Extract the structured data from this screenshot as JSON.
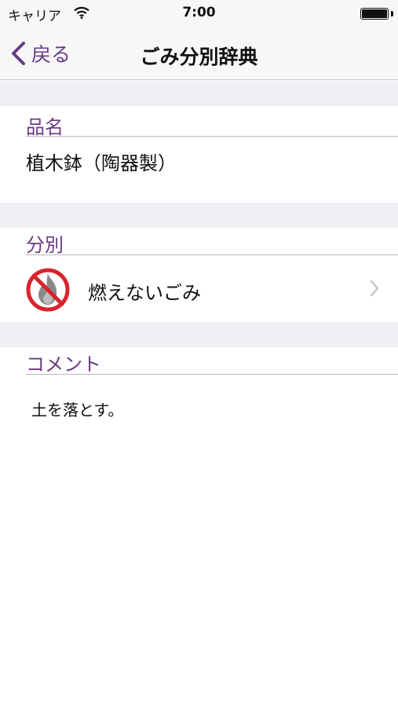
{
  "status_bar": {
    "carrier": "キャリア",
    "time": "7:00"
  },
  "nav": {
    "back_label": "戻る",
    "title": "ごみ分別辞典"
  },
  "sections": {
    "name": {
      "header": "品名",
      "value": "植木鉢（陶器製）"
    },
    "category": {
      "header": "分別",
      "value": "燃えないごみ",
      "icon": "non-burnable-icon"
    },
    "comment": {
      "header": "コメント",
      "value": "土を落とす。"
    }
  },
  "colors": {
    "accent": "#6a3a84",
    "prohibition_red": "#d9232a",
    "separator": "#efeff4"
  }
}
